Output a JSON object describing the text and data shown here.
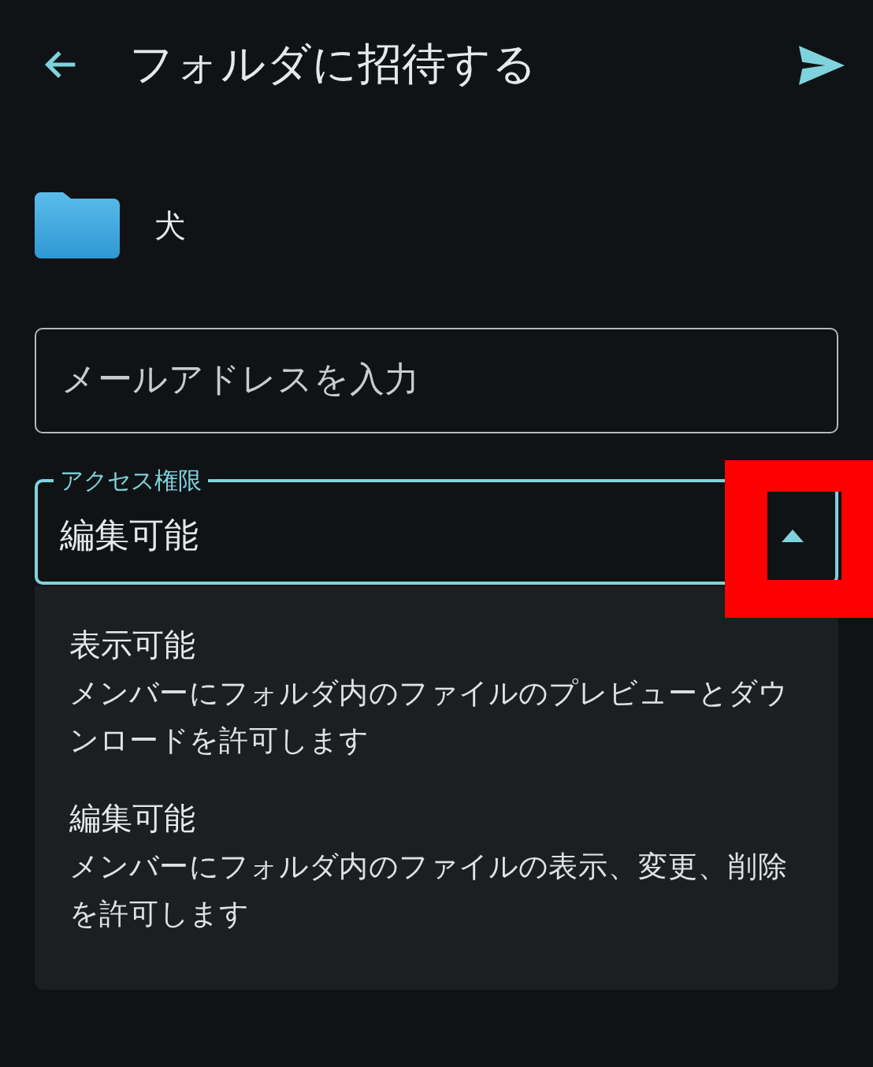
{
  "app_bar": {
    "title": "フォルダに招待する"
  },
  "folder": {
    "name": "犬"
  },
  "email_field": {
    "placeholder": "メールアドレスを入力"
  },
  "access_field": {
    "label": "アクセス権限",
    "value": "編集可能",
    "expanded": true,
    "toggle_highlighted": true
  },
  "options": [
    {
      "title": "表示可能",
      "description": "メンバーにフォルダ内のファイルのプレビューとダウンロードを許可します"
    },
    {
      "title": "編集可能",
      "description": "メンバーにフォルダ内のファイルの表示、変更、削除を許可します"
    }
  ]
}
